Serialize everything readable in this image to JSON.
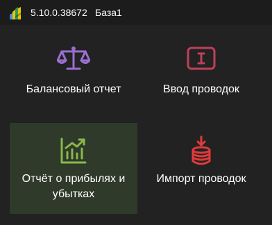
{
  "titlebar": {
    "logo_icon": "app-logo-icon",
    "version": "5.10.0.38672",
    "base_name": "База1"
  },
  "tiles": [
    {
      "label": "Балансовый отчет",
      "icon": "scales-icon",
      "color": "#9b6fd1",
      "selected": false
    },
    {
      "label": "Ввод проводок",
      "icon": "text-input-icon",
      "color": "#c0405a",
      "selected": false
    },
    {
      "label": "Отчёт о прибылях и убытках",
      "icon": "growth-chart-icon",
      "color": "#8ab84a",
      "selected": true
    },
    {
      "label": "Импорт проводок",
      "icon": "database-import-icon",
      "color": "#e03a3a",
      "selected": false
    }
  ]
}
